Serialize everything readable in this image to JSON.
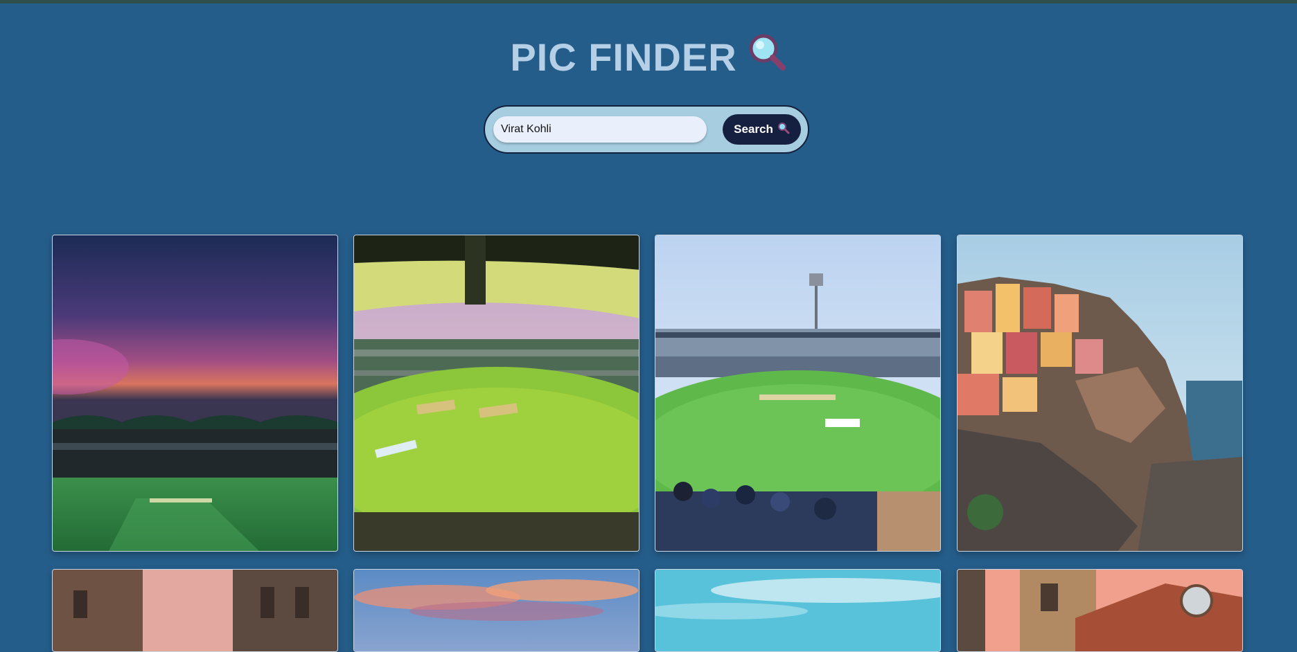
{
  "app": {
    "title": "PIC FINDER",
    "title_icon": "magnifier-icon"
  },
  "search": {
    "value": "Virat Kohli",
    "placeholder": "",
    "button_label": "Search",
    "button_icon": "magnifier-icon"
  },
  "colors": {
    "background": "#255d8a",
    "title": "#b4cfe6",
    "search_container": "#a6cde0",
    "search_button": "#152040"
  },
  "results": [
    {
      "subject": "cricket stadium at dusk with purple sky"
    },
    {
      "subject": "cricket ground viewed from covered stand"
    },
    {
      "subject": "cricket stadium with crowd in foreground"
    },
    {
      "subject": "colorful cliffside village by the sea"
    },
    {
      "subject": "narrow street between old buildings"
    },
    {
      "subject": "sunset clouds over sky"
    },
    {
      "subject": "blue sky with light clouds"
    },
    {
      "subject": "old brick bell tower"
    }
  ]
}
